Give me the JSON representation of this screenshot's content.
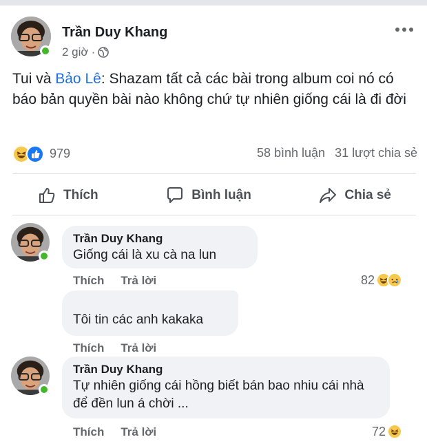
{
  "post": {
    "author": "Trần Duy Khang",
    "time": "2 giờ",
    "separator": "·",
    "text_prefix": "Tui và ",
    "mention": "Bảo Lê",
    "text_suffix": ": Shazam tất cả các bài trong album coi nó có báo bản quyền bài nào không chứ tự nhiên giống cái là đi đời",
    "reaction_count": "979",
    "comments_count": "58 bình luận",
    "shares_count": "31 lượt chia sẻ",
    "icons": {
      "privacy": "globe-icon",
      "more": "more-horizontal-icon"
    }
  },
  "actions": {
    "like": "Thích",
    "comment": "Bình luận",
    "share": "Chia sẻ"
  },
  "comments": [
    {
      "author": "Trần Duy Khang",
      "text": "Giống cái là xu cà na lun",
      "like_label": "Thích",
      "reply_label": "Trả lời",
      "reaction_count": "82"
    },
    {
      "author": "",
      "text": "Tôi tin các anh kakaka",
      "like_label": "Thích",
      "reply_label": "Trả lời",
      "reaction_count": ""
    },
    {
      "author": "Trần Duy Khang",
      "text": "Tự nhiên giống cái hồng biết bán bao nhiu cái nhà để đền lun á chời ...",
      "like_label": "Thích",
      "reply_label": "Trả lời",
      "reaction_count": "72"
    }
  ],
  "colors": {
    "mention": "#216fdb",
    "online": "#44b72a",
    "like_blue": "#1877f2",
    "bubble_bg": "#f0f2f5"
  }
}
